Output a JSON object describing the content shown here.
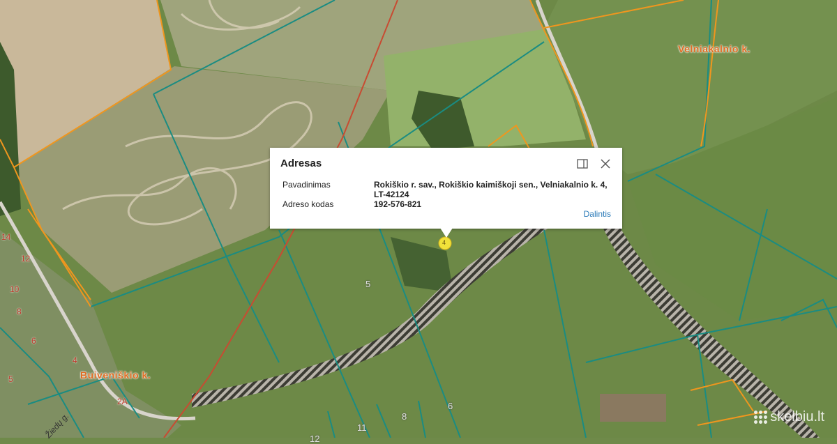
{
  "map": {
    "villages": [
      "Velniakalnio k.",
      "Buiveniškio k."
    ],
    "parcel_numbers": [
      "5",
      "6",
      "8",
      "11",
      "12",
      "14",
      "12",
      "10",
      "8",
      "6",
      "5",
      "4",
      "2A"
    ],
    "street": "Žiedų g.",
    "marker_number": "4",
    "colors": {
      "parcel_boundary": "#1a8c82",
      "road_boundary": "#f0961e",
      "red_line": "#c84b32",
      "road_hatch": "#ffffff"
    }
  },
  "popup": {
    "title": "Adresas",
    "maximize_icon": "maximize-icon",
    "close_icon": "close-icon",
    "rows": [
      {
        "label": "Pavadinimas",
        "value": "Rokiškio r. sav., Rokiškio kaimiškoji sen., Velniakalnio k. 4, LT-42124"
      },
      {
        "label": "Adreso kodas",
        "value": "192-576-821"
      }
    ],
    "share_label": "Dalintis"
  },
  "watermark": {
    "text": "skelbiu.lt"
  }
}
